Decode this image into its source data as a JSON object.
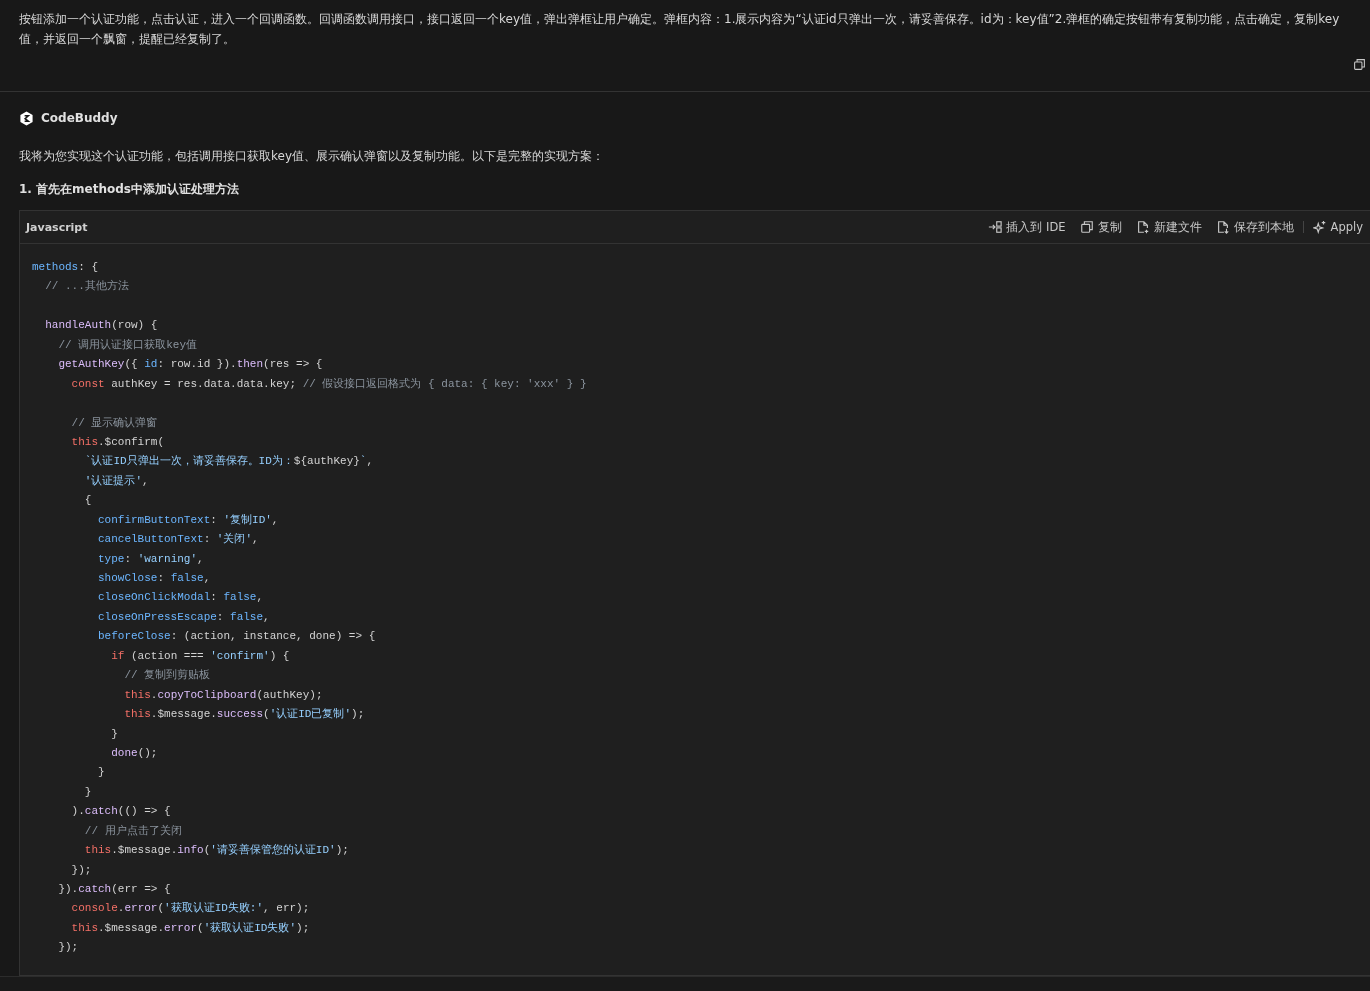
{
  "user_message": {
    "text": "按钮添加一个认证功能，点击认证，进入一个回调函数。回调函数调用接口，接口返回一个key值，弹出弹框让用户确定。弹框内容：1.展示内容为“认证id只弹出一次，请妥善保存。id为：key值”2.弹框的确定按钮带有复制功能，点击确定，复制key值，并返回一个飘窗，提醒已经复制了。"
  },
  "assistant": {
    "name": "CodeBuddy",
    "intro": "我将为您实现这个认证功能，包括调用接口获取key值、展示确认弹窗以及复制功能。以下是完整的实现方案：",
    "heading": "1. 首先在methods中添加认证处理方法"
  },
  "code_block": {
    "language": "Javascript",
    "actions": [
      {
        "kind": "insert",
        "label": "插入到 IDE"
      },
      {
        "kind": "copy",
        "label": "复制"
      },
      {
        "kind": "new",
        "label": "新建文件"
      },
      {
        "kind": "save",
        "label": "保存到本地"
      },
      {
        "kind": "apply",
        "label": "Apply"
      }
    ],
    "lines": [
      {
        "kind": "code",
        "tokens": [
          {
            "kind": "prop",
            "text": "methods"
          },
          {
            "kind": "plain",
            "text": ": {"
          }
        ]
      },
      {
        "kind": "code",
        "tokens": [
          {
            "kind": "comment",
            "text": "  // ...其他方法"
          }
        ]
      },
      {
        "kind": "blank"
      },
      {
        "kind": "code",
        "tokens": [
          {
            "kind": "func",
            "text": "  handleAuth"
          },
          {
            "kind": "plain",
            "text": "(row) {"
          }
        ]
      },
      {
        "kind": "code",
        "tokens": [
          {
            "kind": "comment",
            "text": "    // 调用认证接口获取key值"
          }
        ]
      },
      {
        "kind": "code",
        "tokens": [
          {
            "kind": "func",
            "text": "    getAuthKey"
          },
          {
            "kind": "plain",
            "text": "({ "
          },
          {
            "kind": "prop",
            "text": "id"
          },
          {
            "kind": "plain",
            "text": ": row.id })."
          },
          {
            "kind": "func",
            "text": "then"
          },
          {
            "kind": "plain",
            "text": "(res => {"
          }
        ]
      },
      {
        "kind": "code",
        "tokens": [
          {
            "kind": "keyword",
            "text": "      const"
          },
          {
            "kind": "plain",
            "text": " authKey = res.data.data.key; "
          },
          {
            "kind": "comment",
            "text": "// 假设接口返回格式为 { data: { key: 'xxx' } }"
          }
        ]
      },
      {
        "kind": "blank"
      },
      {
        "kind": "code",
        "tokens": [
          {
            "kind": "comment",
            "text": "      // 显示确认弹窗"
          }
        ]
      },
      {
        "kind": "code",
        "tokens": [
          {
            "kind": "keyword",
            "text": "      this"
          },
          {
            "kind": "plain",
            "text": ".$confirm("
          }
        ]
      },
      {
        "kind": "code",
        "tokens": [
          {
            "kind": "string",
            "text": "        `认证ID只弹出一次，请妥善保存。ID为："
          },
          {
            "kind": "plain",
            "text": "${authKey}"
          },
          {
            "kind": "string",
            "text": "`"
          },
          {
            "kind": "plain",
            "text": ","
          }
        ]
      },
      {
        "kind": "code",
        "tokens": [
          {
            "kind": "string",
            "text": "        '认证提示'"
          },
          {
            "kind": "plain",
            "text": ","
          }
        ]
      },
      {
        "kind": "code",
        "tokens": [
          {
            "kind": "plain",
            "text": "        {"
          }
        ]
      },
      {
        "kind": "code",
        "tokens": [
          {
            "kind": "prop",
            "text": "          confirmButtonText"
          },
          {
            "kind": "plain",
            "text": ": "
          },
          {
            "kind": "string",
            "text": "'复制ID'"
          },
          {
            "kind": "plain",
            "text": ","
          }
        ]
      },
      {
        "kind": "code",
        "tokens": [
          {
            "kind": "prop",
            "text": "          cancelButtonText"
          },
          {
            "kind": "plain",
            "text": ": "
          },
          {
            "kind": "string",
            "text": "'关闭'"
          },
          {
            "kind": "plain",
            "text": ","
          }
        ]
      },
      {
        "kind": "code",
        "tokens": [
          {
            "kind": "prop",
            "text": "          type"
          },
          {
            "kind": "plain",
            "text": ": "
          },
          {
            "kind": "string",
            "text": "'warning'"
          },
          {
            "kind": "plain",
            "text": ","
          }
        ]
      },
      {
        "kind": "code",
        "tokens": [
          {
            "kind": "prop",
            "text": "          showClose"
          },
          {
            "kind": "plain",
            "text": ": "
          },
          {
            "kind": "prop",
            "text": "false"
          },
          {
            "kind": "plain",
            "text": ","
          }
        ]
      },
      {
        "kind": "code",
        "tokens": [
          {
            "kind": "prop",
            "text": "          closeOnClickModal"
          },
          {
            "kind": "plain",
            "text": ": "
          },
          {
            "kind": "prop",
            "text": "false"
          },
          {
            "kind": "plain",
            "text": ","
          }
        ]
      },
      {
        "kind": "code",
        "tokens": [
          {
            "kind": "prop",
            "text": "          closeOnPressEscape"
          },
          {
            "kind": "plain",
            "text": ": "
          },
          {
            "kind": "prop",
            "text": "false"
          },
          {
            "kind": "plain",
            "text": ","
          }
        ]
      },
      {
        "kind": "code",
        "tokens": [
          {
            "kind": "prop",
            "text": "          beforeClose"
          },
          {
            "kind": "plain",
            "text": ": (action, instance, done) => {"
          }
        ]
      },
      {
        "kind": "code",
        "tokens": [
          {
            "kind": "keyword",
            "text": "            if"
          },
          {
            "kind": "plain",
            "text": " (action === "
          },
          {
            "kind": "string",
            "text": "'confirm'"
          },
          {
            "kind": "plain",
            "text": ") {"
          }
        ]
      },
      {
        "kind": "code",
        "tokens": [
          {
            "kind": "comment",
            "text": "              // 复制到剪贴板"
          }
        ]
      },
      {
        "kind": "code",
        "tokens": [
          {
            "kind": "keyword",
            "text": "              this"
          },
          {
            "kind": "plain",
            "text": "."
          },
          {
            "kind": "func",
            "text": "copyToClipboard"
          },
          {
            "kind": "plain",
            "text": "(authKey);"
          }
        ]
      },
      {
        "kind": "code",
        "tokens": [
          {
            "kind": "keyword",
            "text": "              this"
          },
          {
            "kind": "plain",
            "text": ".$message."
          },
          {
            "kind": "func",
            "text": "success"
          },
          {
            "kind": "plain",
            "text": "("
          },
          {
            "kind": "string",
            "text": "'认证ID已复制'"
          },
          {
            "kind": "plain",
            "text": ");"
          }
        ]
      },
      {
        "kind": "code",
        "tokens": [
          {
            "kind": "plain",
            "text": "            }"
          }
        ]
      },
      {
        "kind": "code",
        "tokens": [
          {
            "kind": "func",
            "text": "            done"
          },
          {
            "kind": "plain",
            "text": "();"
          }
        ]
      },
      {
        "kind": "code",
        "tokens": [
          {
            "kind": "plain",
            "text": "          }"
          }
        ]
      },
      {
        "kind": "code",
        "tokens": [
          {
            "kind": "plain",
            "text": "        }"
          }
        ]
      },
      {
        "kind": "code",
        "tokens": [
          {
            "kind": "plain",
            "text": "      )."
          },
          {
            "kind": "func",
            "text": "catch"
          },
          {
            "kind": "plain",
            "text": "(() => {"
          }
        ]
      },
      {
        "kind": "code",
        "tokens": [
          {
            "kind": "comment",
            "text": "        // 用户点击了关闭"
          }
        ]
      },
      {
        "kind": "code",
        "tokens": [
          {
            "kind": "keyword",
            "text": "        this"
          },
          {
            "kind": "plain",
            "text": ".$message."
          },
          {
            "kind": "func",
            "text": "info"
          },
          {
            "kind": "plain",
            "text": "("
          },
          {
            "kind": "string",
            "text": "'请妥善保管您的认证ID'"
          },
          {
            "kind": "plain",
            "text": ");"
          }
        ]
      },
      {
        "kind": "code",
        "tokens": [
          {
            "kind": "plain",
            "text": "      });"
          }
        ]
      },
      {
        "kind": "code",
        "tokens": [
          {
            "kind": "plain",
            "text": "    })."
          },
          {
            "kind": "func",
            "text": "catch"
          },
          {
            "kind": "plain",
            "text": "(err => {"
          }
        ]
      },
      {
        "kind": "code",
        "tokens": [
          {
            "kind": "keyword",
            "text": "      console"
          },
          {
            "kind": "plain",
            "text": "."
          },
          {
            "kind": "func",
            "text": "error"
          },
          {
            "kind": "plain",
            "text": "("
          },
          {
            "kind": "string",
            "text": "'获取认证ID失败:'"
          },
          {
            "kind": "plain",
            "text": ", err);"
          }
        ]
      },
      {
        "kind": "code",
        "tokens": [
          {
            "kind": "keyword",
            "text": "      this"
          },
          {
            "kind": "plain",
            "text": ".$message."
          },
          {
            "kind": "func",
            "text": "error"
          },
          {
            "kind": "plain",
            "text": "("
          },
          {
            "kind": "string",
            "text": "'获取认证ID失败'"
          },
          {
            "kind": "plain",
            "text": ");"
          }
        ]
      },
      {
        "kind": "code",
        "tokens": [
          {
            "kind": "plain",
            "text": "    });"
          }
        ]
      }
    ]
  }
}
